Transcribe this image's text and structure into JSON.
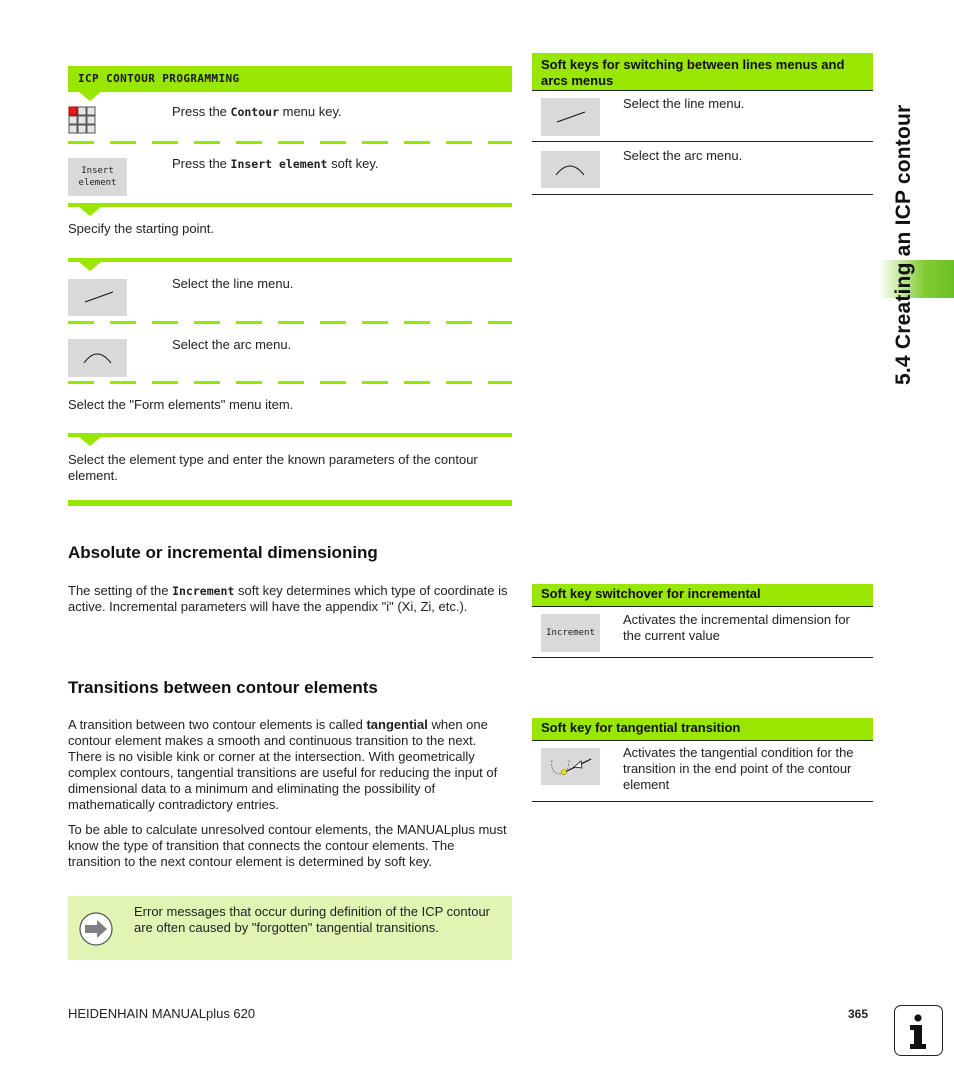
{
  "side_tab": {
    "chapter_title": "5.4 Creating an ICP contour"
  },
  "left": {
    "section_header": "ICP CONTOUR PROGRAMMING",
    "steps": [
      {
        "pre": "Press the ",
        "key": "Contour",
        "post": " menu key.",
        "icon": "contour-menu-grid-icon"
      },
      {
        "pre": "Press the ",
        "key": "Insert element",
        "post": " soft key.",
        "softkey_label_line1": "Insert",
        "softkey_label_line2": "element"
      }
    ],
    "specify_start": "Specify the starting point.",
    "line_menu": "Select the line menu.",
    "arc_menu": "Select the arc menu.",
    "form_elements": "Select the \"Form elements\" menu item.",
    "element_type": "Select the element type and enter the known parameters of the contour element."
  },
  "right_top": {
    "header": "Soft keys for switching between lines menus and arcs menus",
    "rows": [
      {
        "icon": "line-softkey-icon",
        "text": "Select the line menu."
      },
      {
        "icon": "arc-softkey-icon",
        "text": "Select the arc menu."
      }
    ]
  },
  "absolute": {
    "heading": "Absolute or incremental dimensioning",
    "para_pre": "The setting of the ",
    "para_key": "Increment",
    "para_post": " soft key determines which type of coordinate is active. Incremental parameters will have the appendix \"i\" (Xi, Zi, etc.)."
  },
  "incremental_table": {
    "header": "Soft key switchover for incremental",
    "softkey_label": "Increment",
    "text": "Activates the incremental dimension for the current value"
  },
  "transitions": {
    "heading": "Transitions between contour elements",
    "para1_pre": "A transition between two contour elements is called ",
    "para1_bold": "tangential",
    "para1_post": " when one contour element makes a smooth and continuous transition to the next. There is no visible kink or corner at the intersection. With geometrically complex contours, tangential transitions are useful for reducing the input of dimensional data to a minimum and eliminating the possibility of mathematically contradictory entries.",
    "para2": "To be able to calculate unresolved contour elements, the MANUALplus must know the type of transition that connects the contour elements. The transition to the next contour element is determined by soft key."
  },
  "tangential_table": {
    "header": "Soft key for tangential transition",
    "text": "Activates the tangential condition for the transition in the end point of the contour element"
  },
  "note": {
    "text": "Error messages that occur during definition of the ICP contour are often caused by \"forgotten\" tangential transitions."
  },
  "footer": {
    "manual_name": "HEIDENHAIN MANUALplus 620",
    "page_number": "365",
    "info_icon": "i"
  }
}
